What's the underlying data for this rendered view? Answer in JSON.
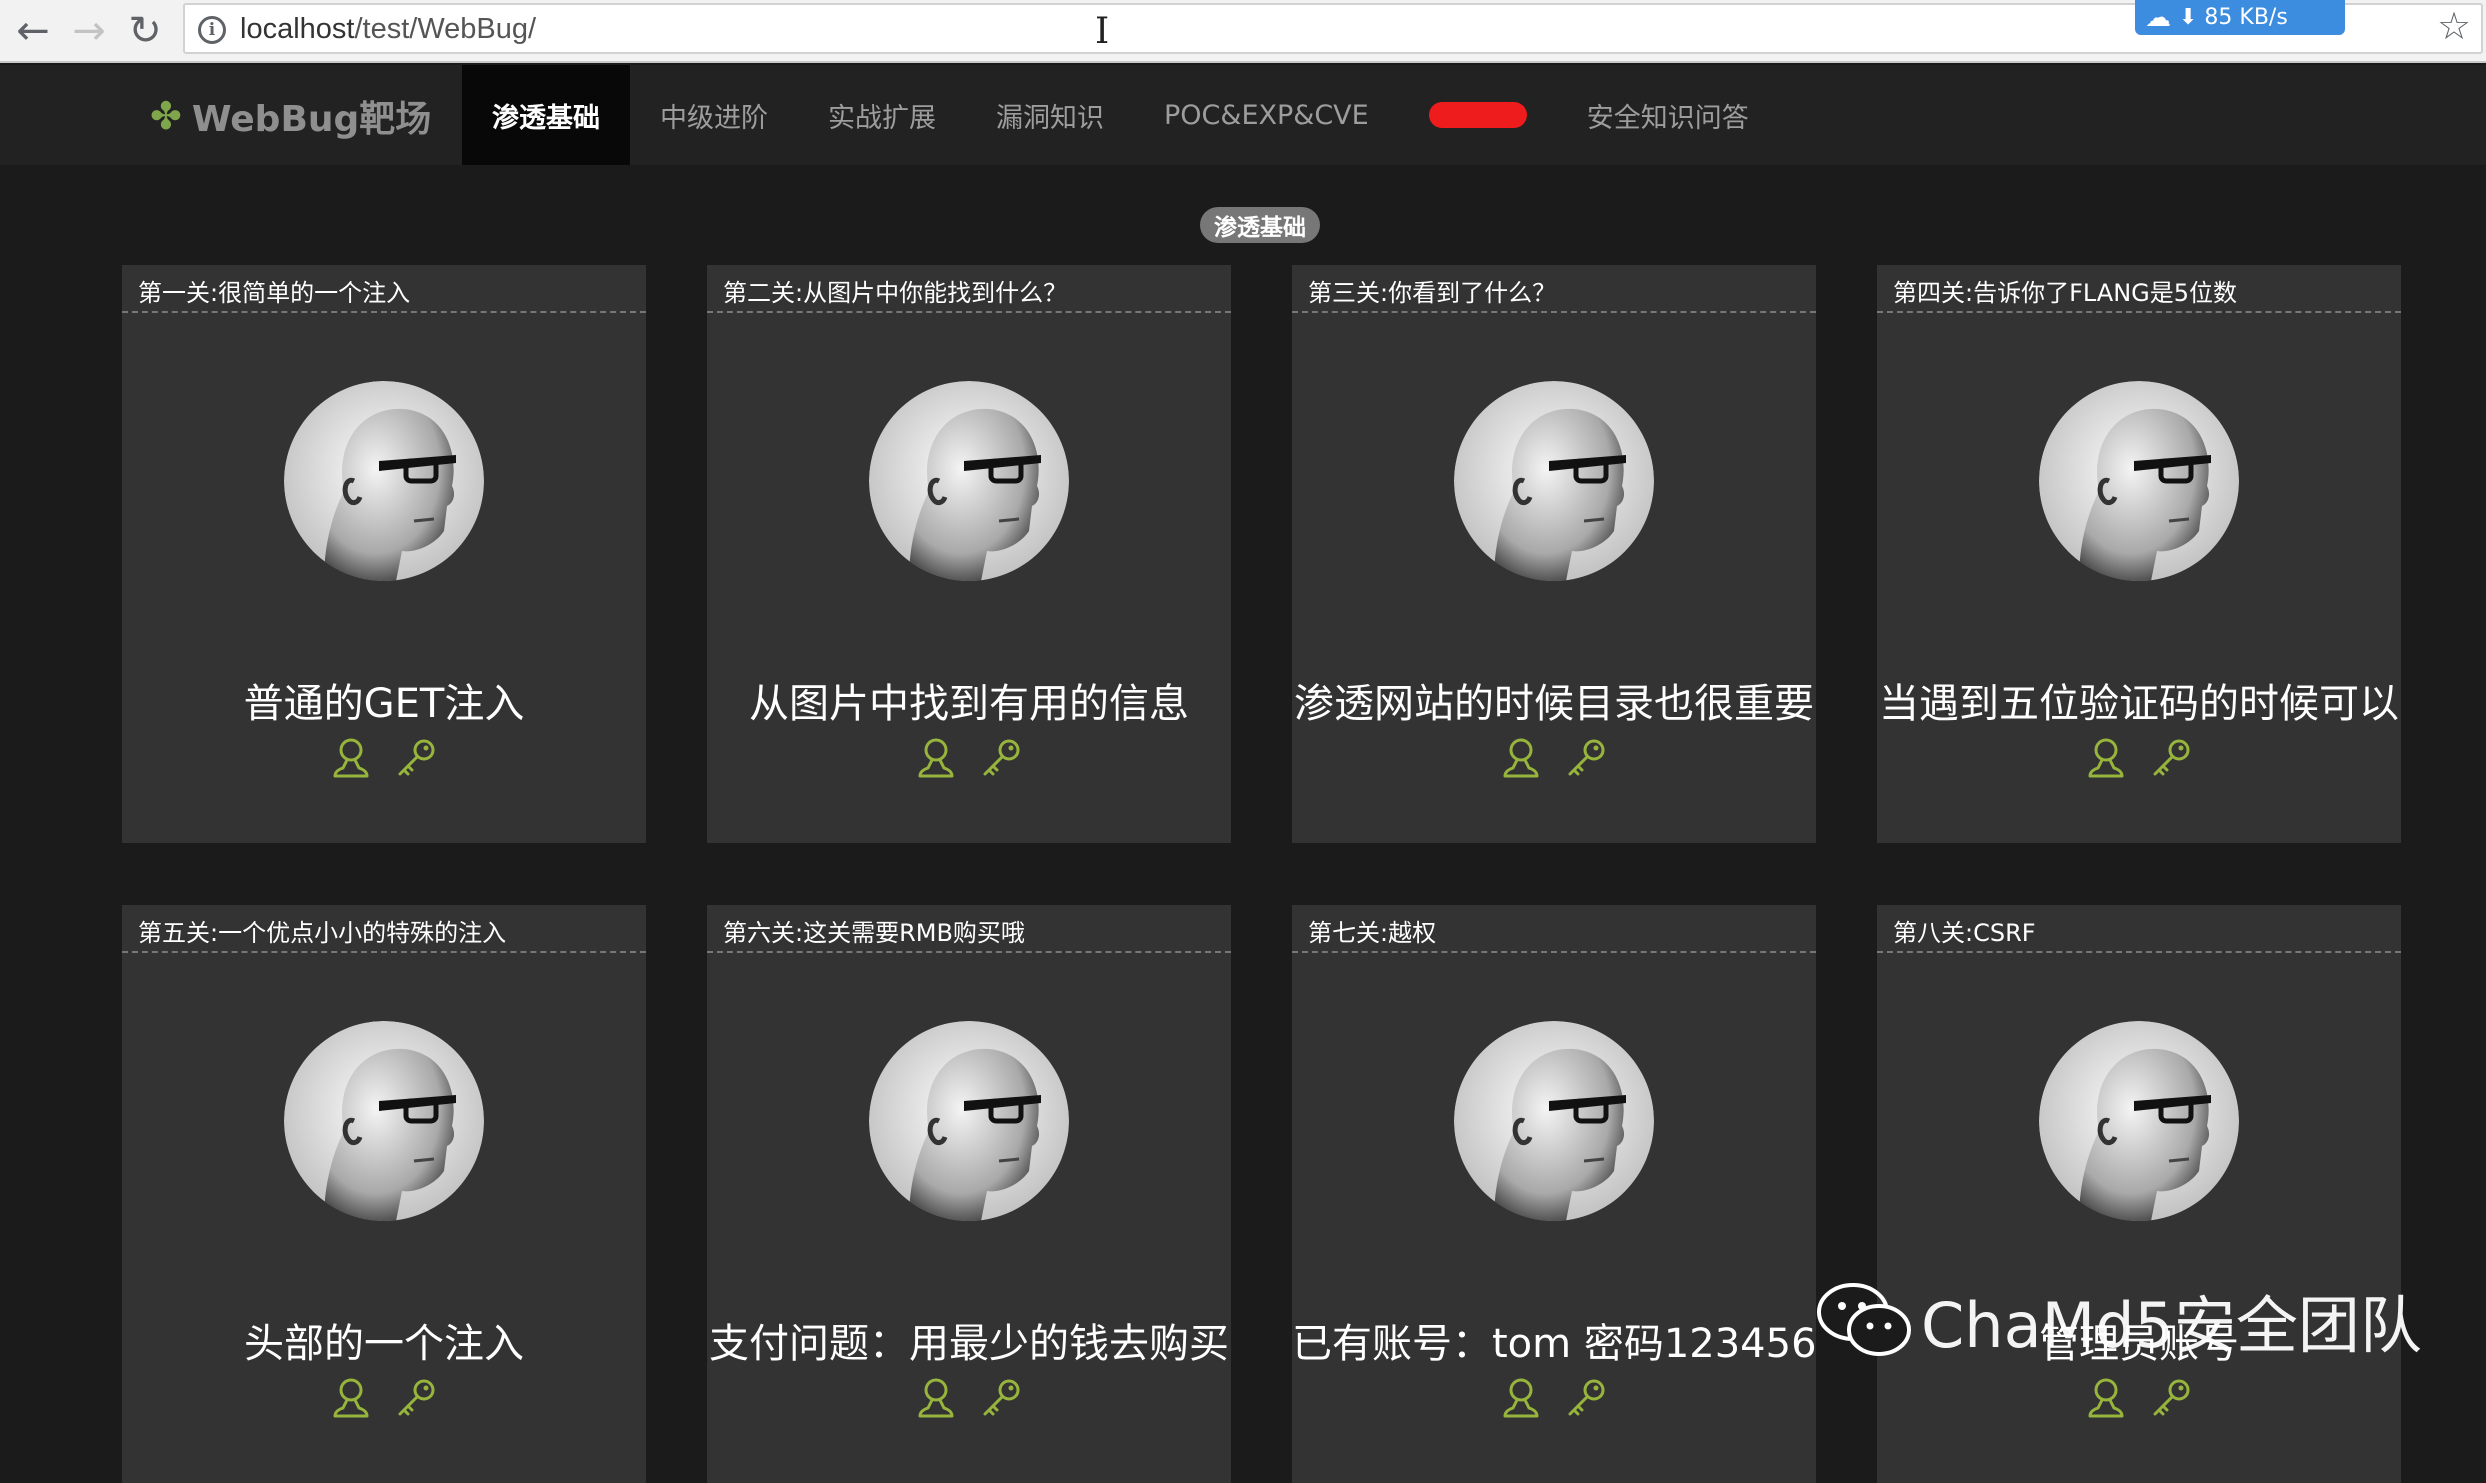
{
  "browser": {
    "url_host": "localhost",
    "url_path": "/test/WebBug/",
    "download_speed": "⬇ 85 KB/s",
    "back_glyph": "←",
    "forward_glyph": "→",
    "reload_glyph": "↻",
    "star_glyph": "☆",
    "info_glyph": "i",
    "cursor_glyph": "I",
    "cloud_glyph": "☁"
  },
  "nav": {
    "brand": "WebBug靶场",
    "brand_icon": "✤",
    "items": [
      {
        "label": "渗透基础",
        "active": true
      },
      {
        "label": "中级进阶",
        "active": false
      },
      {
        "label": "实战扩展",
        "active": false
      },
      {
        "label": "漏洞知识",
        "active": false
      },
      {
        "label": "POC&EXP&CVE",
        "active": false
      },
      {
        "label": "",
        "active": false
      },
      {
        "label": "安全知识问答",
        "active": false
      }
    ]
  },
  "section_badge": "渗透基础",
  "cards": [
    {
      "header": "第一关:很简单的一个注入",
      "title": "普通的GET注入"
    },
    {
      "header": "第二关:从图片中你能找到什么？",
      "title": "从图片中找到有用的信息"
    },
    {
      "header": "第三关:你看到了什么？",
      "title": "渗透网站的时候目录也很重要"
    },
    {
      "header": "第四关:告诉你了FLANG是5位数",
      "title": "当遇到五位验证码的时候可以"
    },
    {
      "header": "第五关:一个优点小小的特殊的注入",
      "title": "头部的一个注入"
    },
    {
      "header": "第六关:这关需要RMB购买哦",
      "title": "支付问题：用最少的钱去购买"
    },
    {
      "header": "第七关:越权",
      "title": "已有账号：tom 密码123456"
    },
    {
      "header": "第八关:CSRF",
      "title": "管理员账号"
    }
  ],
  "watermark": "ChaMd5安全团队",
  "colors": {
    "accent_icon": "#97b43c",
    "redaction": "#ee1c1c",
    "card_bg": "#333333",
    "page_bg": "#1b1b1b"
  }
}
